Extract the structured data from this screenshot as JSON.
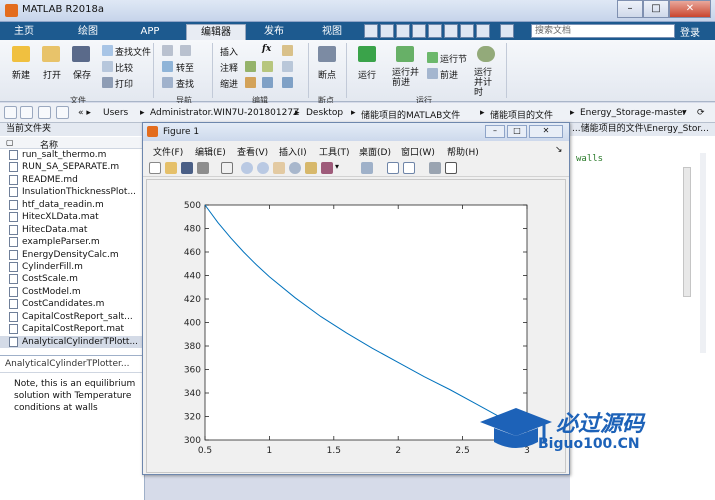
{
  "window": {
    "title": "MATLAB R2018a"
  },
  "tabs": [
    {
      "label": "主页",
      "active": false
    },
    {
      "label": "绘图",
      "active": false
    },
    {
      "label": "APP",
      "active": false
    },
    {
      "label": "编辑器",
      "active": true
    },
    {
      "label": "发布",
      "active": false
    },
    {
      "label": "视图",
      "active": false
    }
  ],
  "search": {
    "placeholder": "搜索文档"
  },
  "login_label": "登录",
  "ribbon": {
    "file_group": {
      "name": "文件",
      "new": "新建",
      "open": "打开",
      "save": "保存",
      "find_files": "查找文件",
      "compare": "比较",
      "print": "打印"
    },
    "nav_group": {
      "name": "导航",
      "goto": "转至",
      "find": "查找"
    },
    "edit_group": {
      "name": "编辑",
      "insert": "插入",
      "comment": "注释",
      "indent": "缩进",
      "fx": "fx"
    },
    "breakpoints_group": {
      "name": "断点",
      "breakpoints": "断点"
    },
    "run_group": {
      "name": "运行",
      "run": "运行",
      "run_advance": "运行并前进",
      "run_section": "运行节",
      "advance": "前进",
      "run_time": "运行并计时"
    }
  },
  "address": {
    "crumbs": [
      "Users",
      "Administrator.WIN7U-20180127Z",
      "Desktop",
      "储能项目的MATLAB文件",
      "储能项目的文件",
      "Energy_Storage-master"
    ]
  },
  "current_folder": {
    "header": "当前文件夹",
    "column": "名称",
    "files": [
      "run_salt_thermo.m",
      "RUN_SA_SEPARATE.m",
      "README.md",
      "InsulationThicknessPlot...",
      "htf_data_readin.m",
      "HitecXLData.mat",
      "HitecData.mat",
      "exampleParser.m",
      "EnergyDensityCalc.m",
      "CylinderFill.m",
      "CostScale.m",
      "CostModel.m",
      "CostCandidates.m",
      "CapitalCostReport_salt...",
      "CapitalCostReport.mat",
      "AnalyticalCylinderTPlott..."
    ],
    "selected_index": 15
  },
  "details": {
    "title": "AnalyticalCylinderTPlotter...",
    "text": [
      "Note, this is an equilibrium",
      "solution with Temperature",
      "conditions at walls"
    ]
  },
  "editor": {
    "path_tail": "...储能项目的文件\\Energy_Stor...",
    "code_snippet": "walls"
  },
  "figure": {
    "title": "Figure 1",
    "menu": [
      "文件(F)",
      "编辑(E)",
      "查看(V)",
      "插入(I)",
      "工具(T)",
      "桌面(D)",
      "窗口(W)",
      "帮助(H)"
    ]
  },
  "chart_data": {
    "type": "line",
    "title": "",
    "xlabel": "",
    "ylabel": "",
    "xlim": [
      0.5,
      3
    ],
    "ylim": [
      300,
      500
    ],
    "xticks": [
      "0.5",
      "1",
      "1.5",
      "2",
      "2.5",
      "3"
    ],
    "yticks": [
      "300",
      "320",
      "340",
      "360",
      "380",
      "400",
      "420",
      "440",
      "460",
      "480",
      "500"
    ],
    "grid": false,
    "color": "#0072bd",
    "series": [
      {
        "x": [
          0.5,
          0.6,
          0.7,
          0.8,
          0.9,
          1.0,
          1.2,
          1.4,
          1.6,
          1.8,
          2.0,
          2.2,
          2.4,
          2.6,
          2.8,
          3.0
        ],
        "y": [
          500,
          485,
          472,
          460,
          449,
          439,
          421,
          405,
          391,
          378,
          366,
          354,
          343,
          331,
          319,
          308
        ]
      }
    ]
  },
  "watermark": {
    "text1": "必过源码",
    "text2": "Biguo100.CN"
  },
  "colors": {
    "tabbar": "#1d5a8f",
    "line": "#0072bd"
  }
}
